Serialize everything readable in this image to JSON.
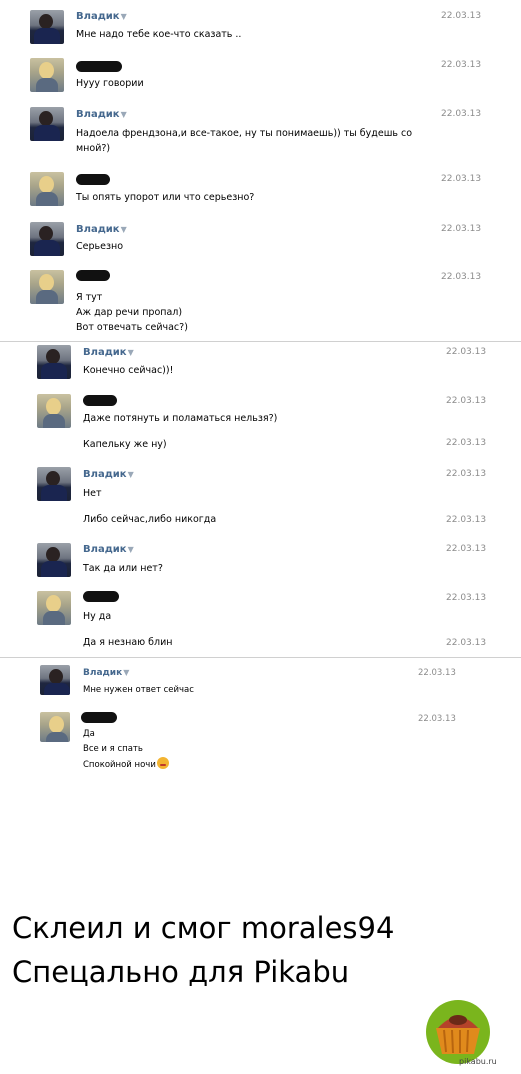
{
  "messages": [
    {
      "sender": "Владик",
      "avatar": "vladik",
      "date": "22.03.13",
      "lines": [
        "Мне надо тебе кое-что сказать .."
      ]
    },
    {
      "sender": "",
      "avatar": "girl",
      "date": "22.03.13",
      "lines": [
        "Нууу говории"
      ]
    },
    {
      "sender": "Владик",
      "avatar": "vladik",
      "date": "22.03.13",
      "lines": [
        "Надоела френдзона,и все-такое, ну ты понимаешь)) ты будешь со",
        "мной?)"
      ]
    },
    {
      "sender": "",
      "avatar": "girl",
      "date": "22.03.13",
      "lines": [
        "Ты опять упорот или что серьезно?"
      ]
    },
    {
      "sender": "Владик",
      "avatar": "vladik",
      "date": "22.03.13",
      "lines": [
        "Серьезно"
      ]
    },
    {
      "sender": "",
      "avatar": "girl",
      "date": "22.03.13",
      "lines": [
        "Я тут",
        "Аж дар речи пропал)",
        "Вот отвечать сейчас?)"
      ]
    },
    {
      "sender": "Владик",
      "avatar": "vladik",
      "date": "22.03.13",
      "lines": [
        "Конечно сейчас))!"
      ]
    },
    {
      "sender": "",
      "avatar": "girl",
      "date": "22.03.13",
      "lines": [
        "Даже потянуть и поламаться нельзя?)"
      ]
    },
    {
      "sender": "",
      "avatar": "",
      "date": "22.03.13",
      "lines": [
        "Капельку же ну)"
      ]
    },
    {
      "sender": "Владик",
      "avatar": "vladik",
      "date": "22.03.13",
      "lines": [
        "Нет"
      ]
    },
    {
      "sender": "",
      "avatar": "",
      "date": "22.03.13",
      "lines": [
        "Либо сейчас,либо никогда"
      ]
    },
    {
      "sender": "Владик",
      "avatar": "vladik",
      "date": "22.03.13",
      "lines": [
        "Так да или нет?"
      ]
    },
    {
      "sender": "",
      "avatar": "girl",
      "date": "22.03.13",
      "lines": [
        "Ну да"
      ]
    },
    {
      "sender": "",
      "avatar": "",
      "date": "22.03.13",
      "lines": [
        "Да я незнаю блин"
      ]
    },
    {
      "sender": "Владик",
      "avatar": "vladik",
      "date": "22.03.13",
      "lines": [
        "Мне нужен ответ сейчас"
      ]
    },
    {
      "sender": "",
      "avatar": "girl",
      "date": "22.03.13",
      "lines": [
        "Да",
        "Все и я спать",
        "Спокойной ночи"
      ]
    }
  ],
  "caption": {
    "line1": "Склеил и смог morales94",
    "line2": "Спецально для Pikabu"
  },
  "watermark": "pikabu.ru",
  "icons": {
    "emoji": "kiss-emoji-icon",
    "logo": "pikabu-muffin-logo",
    "dropdown": "triangle-down-icon"
  },
  "colors": {
    "name": "#45688e",
    "date": "#8c8c8c",
    "text": "#000000"
  }
}
